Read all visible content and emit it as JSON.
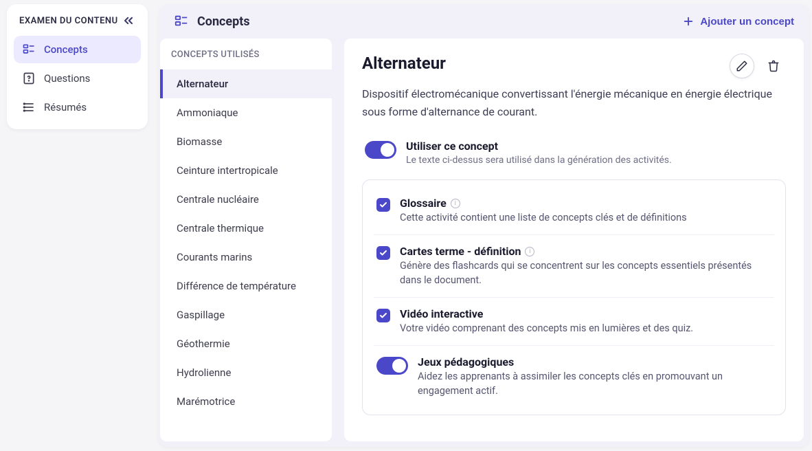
{
  "sidebar": {
    "title": "EXAMEN DU CONTENU",
    "items": [
      {
        "label": "Concepts",
        "active": true
      },
      {
        "label": "Questions",
        "active": false
      },
      {
        "label": "Résumés",
        "active": false
      }
    ]
  },
  "header": {
    "title": "Concepts",
    "add_button": "Ajouter un concept"
  },
  "concept_list": {
    "label": "CONCEPTS UTILISÉS",
    "items": [
      "Alternateur",
      "Ammoniaque",
      "Biomasse",
      "Ceinture intertropicale",
      "Centrale nucléaire",
      "Centrale thermique",
      "Courants marins",
      "Différence de température",
      "Gaspillage",
      "Géothermie",
      "Hydrolienne",
      "Marémotrice"
    ],
    "active_index": 0
  },
  "detail": {
    "title": "Alternateur",
    "description": "Dispositif électromécanique convertissant l'énergie mécanique en énergie électrique sous forme d'alternance de courant.",
    "use_concept": {
      "title": "Utiliser ce concept",
      "subtitle": "Le texte ci-dessus sera utilisé dans la génération des activités.",
      "enabled": true
    },
    "activities": [
      {
        "type": "checkbox",
        "title": "Glossaire",
        "desc": "Cette activité contient une liste de concepts clés et de définitions",
        "info": true
      },
      {
        "type": "checkbox",
        "title": "Cartes terme - définition",
        "desc": "Génère des flashcards qui se concentrent sur les concepts essentiels présentés dans le document.",
        "info": true
      },
      {
        "type": "checkbox",
        "title": "Vidéo interactive",
        "desc": "Votre vidéo comprenant des concepts mis en lumières et des quiz.",
        "info": false
      },
      {
        "type": "toggle",
        "title": "Jeux pédagogiques",
        "desc": "Aidez les apprenants à assimiler les concepts clés en promouvant un engagement actif.",
        "info": false
      }
    ]
  }
}
